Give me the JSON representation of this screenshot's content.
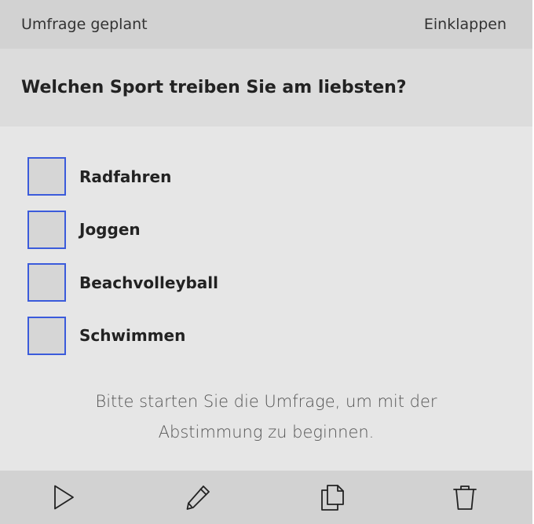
{
  "header": {
    "status": "Umfrage geplant",
    "collapse_label": "Einklappen"
  },
  "poll": {
    "question": "Welchen Sport treiben Sie am liebsten?",
    "options": [
      {
        "label": "Radfahren",
        "checked": false
      },
      {
        "label": "Joggen",
        "checked": false
      },
      {
        "label": "Beachvolleyball",
        "checked": false
      },
      {
        "label": "Schwimmen",
        "checked": false
      }
    ],
    "hint": "Bitte starten Sie die Umfrage, um mit der Abstimmung zu beginnen."
  },
  "toolbar": {
    "icons": [
      "play-icon",
      "pencil-icon",
      "copy-icon",
      "trash-icon"
    ]
  },
  "colors": {
    "checkbox_border": "#3b5bdb",
    "header_bg": "#d2d2d2",
    "panel_bg": "#e6e6e6"
  }
}
